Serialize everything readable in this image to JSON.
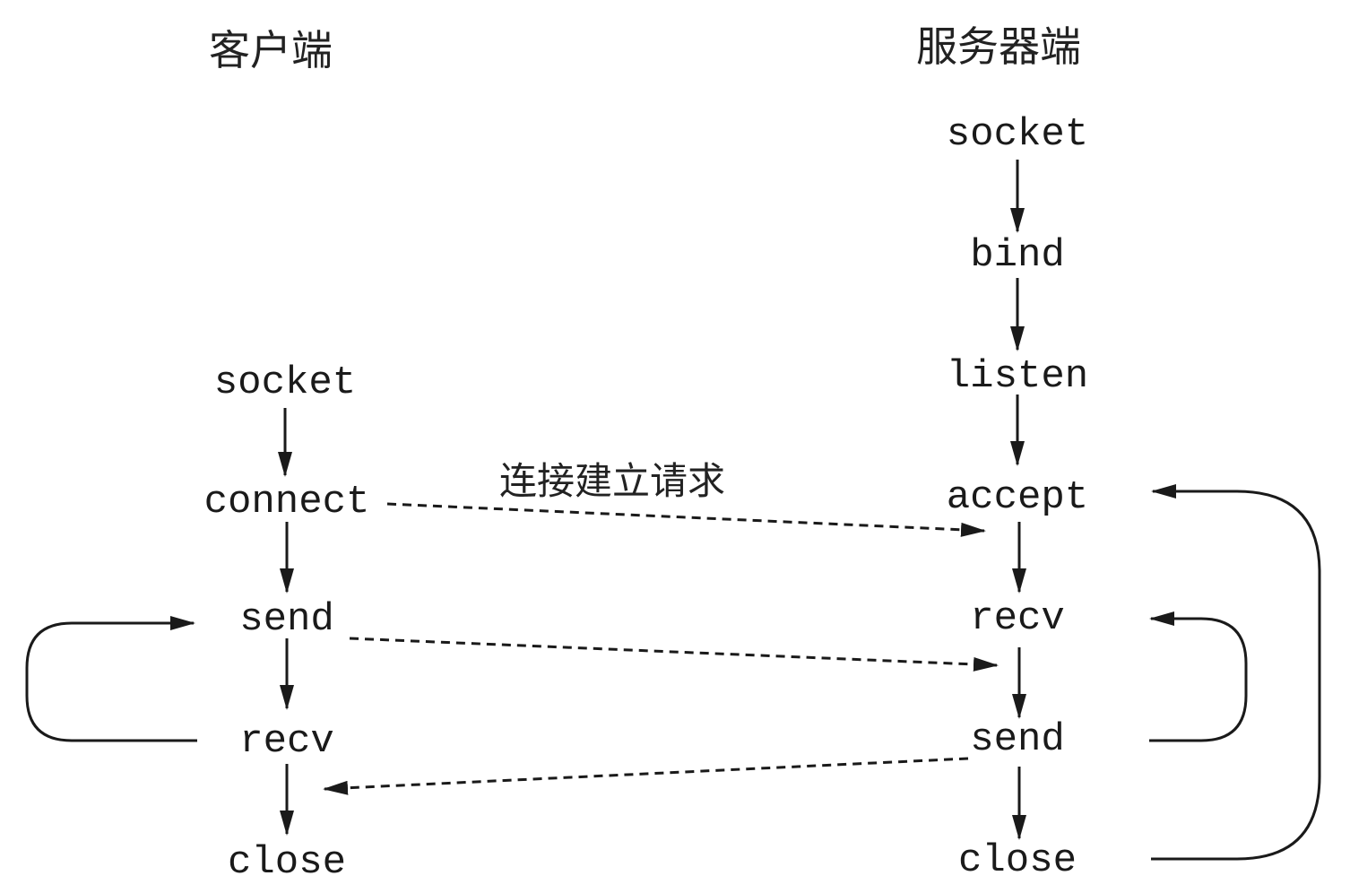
{
  "client": {
    "heading": "客户端",
    "steps": {
      "socket": "socket",
      "connect": "connect",
      "send": "send",
      "recv": "recv",
      "close": "close"
    }
  },
  "server": {
    "heading": "服务器端",
    "steps": {
      "socket": "socket",
      "bind": "bind",
      "listen": "listen",
      "accept": "accept",
      "recv": "recv",
      "send": "send",
      "close": "close"
    }
  },
  "annotations": {
    "connect_request": "连接建立请求"
  }
}
